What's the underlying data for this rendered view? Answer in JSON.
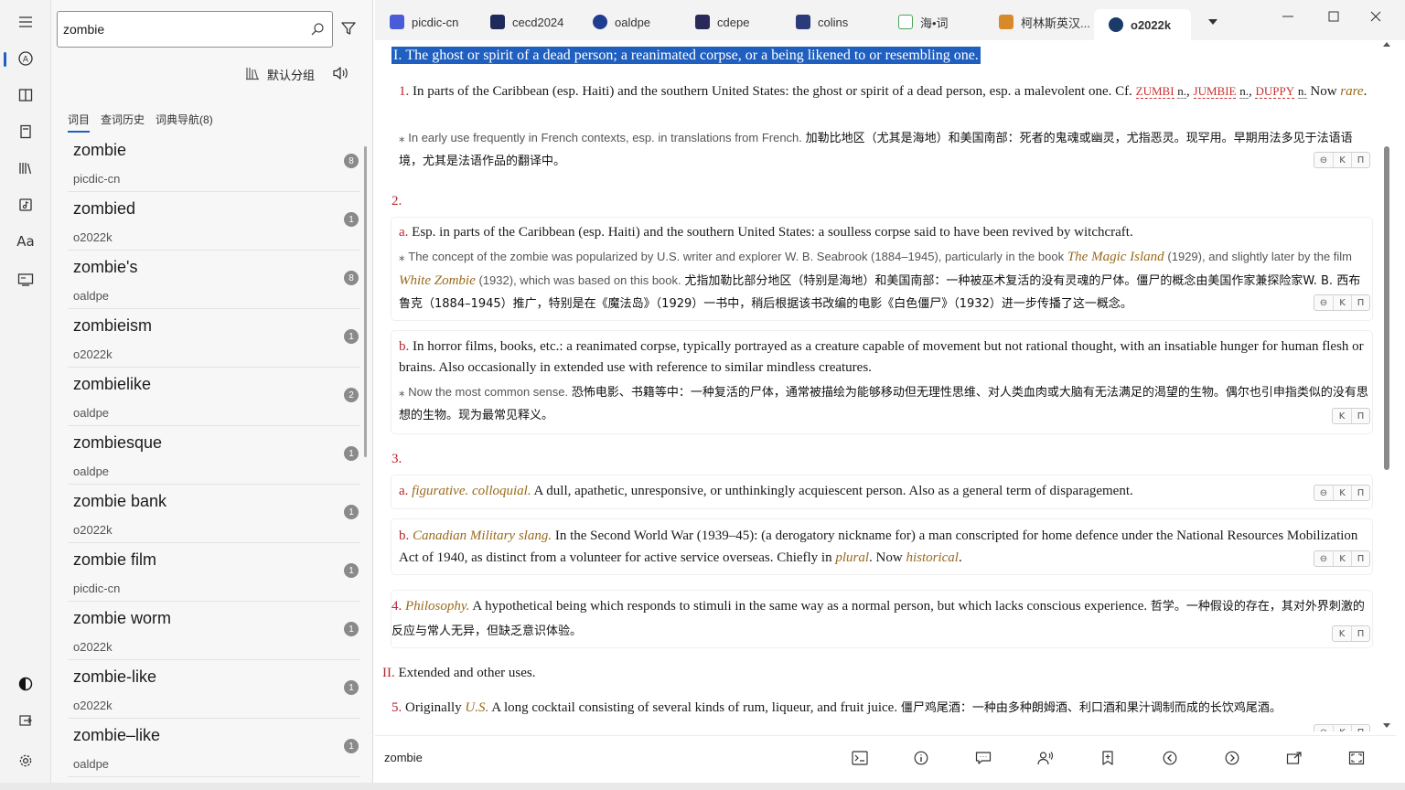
{
  "rail": {
    "items": [
      "menu-icon",
      "lookup-icon",
      "book-icon",
      "notebook-icon",
      "library-icon",
      "audio-book-icon",
      "font-icon",
      "screen-icon"
    ],
    "font_label": "Aa",
    "bottom": [
      "contrast-icon",
      "exit-icon",
      "settings-icon"
    ]
  },
  "search": {
    "value": "zombie",
    "placeholder": ""
  },
  "group": {
    "label": "默认分组"
  },
  "subtabs": [
    "词目",
    "查词历史",
    "词典导航(8)"
  ],
  "list": [
    {
      "word": "zombie",
      "source": "picdic-cn",
      "count": "8"
    },
    {
      "word": "zombied",
      "source": "o2022k",
      "count": "1"
    },
    {
      "word": "zombie's",
      "source": "oaldpe",
      "count": "8"
    },
    {
      "word": "zombieism",
      "source": "o2022k",
      "count": "1"
    },
    {
      "word": "zombielike",
      "source": "oaldpe",
      "count": "2"
    },
    {
      "word": "zombiesque",
      "source": "oaldpe",
      "count": "1"
    },
    {
      "word": "zombie bank",
      "source": "o2022k",
      "count": "1"
    },
    {
      "word": "zombie film",
      "source": "picdic-cn",
      "count": "1"
    },
    {
      "word": "zombie worm",
      "source": "o2022k",
      "count": "1"
    },
    {
      "word": "zombie-like",
      "source": "o2022k",
      "count": "1"
    },
    {
      "word": "zombie–like",
      "source": "oaldpe",
      "count": "1"
    }
  ],
  "tabs": [
    {
      "label": "picdic-cn",
      "color": "#4a5bd8"
    },
    {
      "label": "cecd2024",
      "color": "#1d2a5a"
    },
    {
      "label": "oaldpe",
      "color": "#1e3d8f"
    },
    {
      "label": "cdepe",
      "color": "#2a2a5a"
    },
    {
      "label": "colins",
      "color": "#2b3a7a"
    },
    {
      "label": "海•词",
      "color": "#4aa35a"
    },
    {
      "label": "柯林斯英汉...",
      "color": "#d88a2a"
    },
    {
      "label": "o2022k",
      "color": "#1a3a6a"
    }
  ],
  "entry": {
    "s1": {
      "num": "I.",
      "text": "The ghost or spirit of a dead person; a reanimated corpse, or a being likened to or resembling one."
    },
    "d1": {
      "num": "1.",
      "text": "In parts of the Caribbean (esp. Haiti) and the southern United States: the ghost or spirit of a dead person, esp. a malevolent one. Cf.",
      "xref1": "zumbi",
      "xref2": "jumbie",
      "xref3": "duppy",
      "n": "n.",
      "now": "Now",
      "rare": "rare",
      "note": "In early use frequently in French contexts, esp. in translations from French.",
      "zh": "加勒比地区（尤其是海地）和美国南部：死者的鬼魂或幽灵，尤指恶灵。现罕用。早期用法多见于法语语境，尤其是法语作品的翻译中。"
    },
    "d2": {
      "num": "2."
    },
    "d2a": {
      "num": "a.",
      "text": "Esp. in parts of the Caribbean (esp. Haiti) and the southern United States: a soulless corpse said to have been revived by witchcraft.",
      "note1": "The concept of the zombie was popularized by U.S. writer and explorer W. B. Seabrook (1884–1945), particularly in the book",
      "book": "The Magic Island",
      "note2": "(1929), and slightly later by the film",
      "film": "White Zombie",
      "note3": "(1932), which was based on this book.",
      "zh": "尤指加勒比部分地区（特别是海地）和美国南部：一种被巫术复活的没有灵魂的尸体。僵尸的概念由美国作家兼探险家W. B. 西布鲁克（1884–1945）推广，特别是在《魔法岛》（1929）一书中，稍后根据该书改编的电影《白色僵尸》（1932）进一步传播了这一概念。"
    },
    "d2b": {
      "num": "b.",
      "text": "In horror films, books, etc.: a reanimated corpse, typically portrayed as a creature capable of movement but not rational thought, with an insatiable hunger for human flesh or brains. Also occasionally in extended use with reference to similar mindless creatures.",
      "note": "Now the most common sense.",
      "zh": "恐怖电影、书籍等中：一种复活的尸体，通常被描绘为能够移动但无理性思维、对人类血肉或大脑有无法满足的渴望的生物。偶尔也引申指类似的没有思想的生物。现为最常见释义。"
    },
    "d3": {
      "num": "3."
    },
    "d3a": {
      "num": "a.",
      "label": "figurative. colloquial.",
      "text": "A dull, apathetic, unresponsive, or unthinkingly acquiescent person. Also as a general term of disparagement."
    },
    "d3b": {
      "num": "b.",
      "label": "Canadian Military slang.",
      "text": "In the Second World War (1939–45): (a derogatory nickname for) a man conscripted for home defence under the National Resources Mobilization Act of 1940, as distinct from a volunteer for active service overseas. Chiefly in",
      "plural": "plural",
      "now": ". Now",
      "hist": "historical",
      "end": "."
    },
    "d4": {
      "num": "4.",
      "label": "Philosophy.",
      "text": "A hypothetical being which responds to stimuli in the same way as a normal person, but which lacks conscious experience.",
      "zh": "哲学。一种假设的存在，其对外界刺激的反应与常人无异，但缺乏意识体验。"
    },
    "s2": {
      "num": "II.",
      "text": "Extended and other uses."
    },
    "d5": {
      "num": "5.",
      "pre": "Originally",
      "us": "U.S.",
      "text": "A long cocktail consisting of several kinds of rum, liqueur, and fruit juice.",
      "zh": "僵尸鸡尾酒：一种由多种朗姆酒、利口酒和果汁调制而成的长饮鸡尾酒。"
    },
    "btns3": [
      "⊖",
      "K",
      "П"
    ],
    "btns2": [
      "K",
      "П"
    ]
  },
  "bottom": {
    "word": "zombie"
  }
}
